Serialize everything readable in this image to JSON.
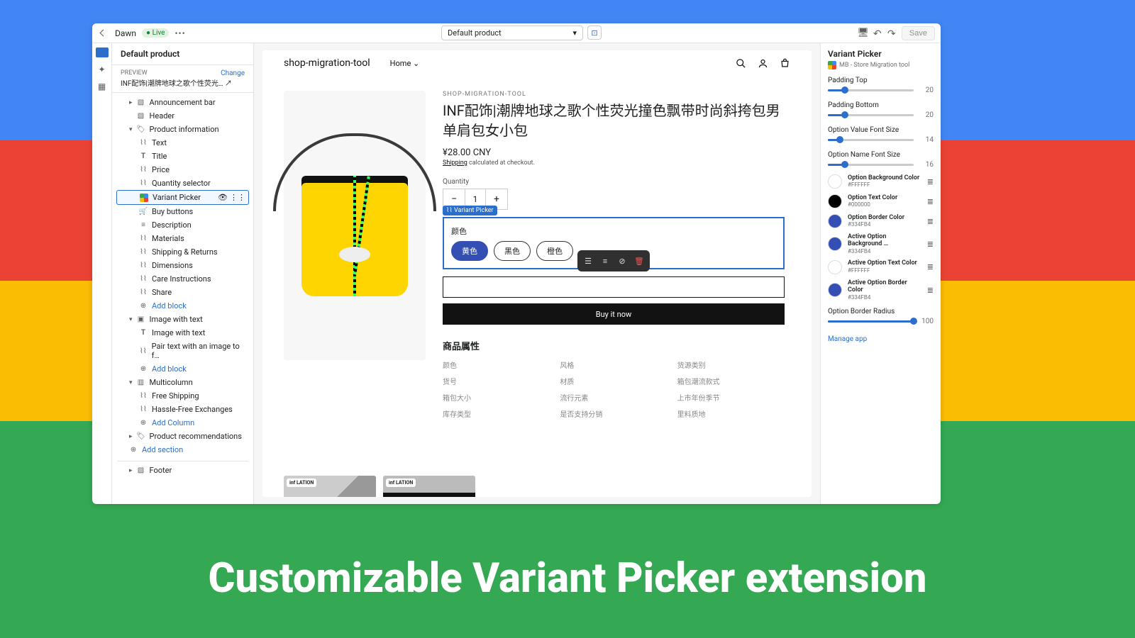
{
  "banner": "Customizable Variant Picker extension",
  "topbar": {
    "theme_name": "Dawn",
    "live_status": "Live",
    "template_select": "Default product",
    "save_label": "Save"
  },
  "left_panel": {
    "template_title": "Default product",
    "preview_label": "PREVIEW",
    "change_label": "Change",
    "preview_product": "INF配饰|潮牌地球之歌个性荧光…",
    "announcement_bar": "Announcement bar",
    "header": "Header",
    "product_info": "Product information",
    "text": "Text",
    "title": "Title",
    "price": "Price",
    "qty_selector": "Quantity selector",
    "variant_picker": "Variant Picker",
    "buy_buttons": "Buy buttons",
    "description": "Description",
    "materials": "Materials",
    "shipping_returns": "Shipping & Returns",
    "dimensions": "Dimensions",
    "care": "Care Instructions",
    "share": "Share",
    "add_block": "Add block",
    "image_with_text": "Image with text",
    "image_with_text_block": "Image with text",
    "pair_text": "Pair text with an image to f…",
    "multicolumn": "Multicolumn",
    "free_shipping": "Free Shipping",
    "hassle_free": "Hassle-Free Exchanges",
    "add_column": "Add Column",
    "product_recs": "Product recommendations",
    "add_section": "Add section",
    "footer": "Footer"
  },
  "store": {
    "name": "shop-migration-tool",
    "home": "Home",
    "vendor": "SHOP-MIGRATION-TOOL",
    "product_title": "INF配饰|潮牌地球之歌个性荧光撞色飘带时尚斜挎包男单肩包女小包",
    "price": "¥28.00 CNY",
    "shipping_link": "Shipping",
    "shipping_text": "calculated at checkout.",
    "quantity_label": "Quantity",
    "quantity_value": "1",
    "variant_tag": "Variant Picker",
    "option_name": "颜色",
    "option_yellow": "黄色",
    "option_black": "黑色",
    "option_orange": "橙色",
    "buy_it_now": "Buy it now",
    "attrs_title": "商品属性",
    "attrs": [
      "颜色",
      "风格",
      "货源类别",
      "货号",
      "材质",
      "箱包潮流款式",
      "箱包大小",
      "流行元素",
      "上市年份季节",
      "库存类型",
      "是否支持分销",
      "里料质地"
    ],
    "thumb_logo": "inf LATION"
  },
  "right_panel": {
    "title": "Variant Picker",
    "app_name": "MB - Store Migration tool",
    "padding_top_label": "Padding Top",
    "padding_top_val": "20",
    "padding_bottom_label": "Padding Bottom",
    "padding_bottom_val": "20",
    "opt_val_font_label": "Option Value Font Size",
    "opt_val_font_val": "14",
    "opt_name_font_label": "Option Name Font Size",
    "opt_name_font_val": "16",
    "border_radius_label": "Option Border Radius",
    "border_radius_val": "100",
    "manage_app": "Manage app",
    "colors": [
      {
        "label": "Option Background Color",
        "hex": "#FFFFFF",
        "swatch": "#FFFFFF"
      },
      {
        "label": "Option Text Color",
        "hex": "#000000",
        "swatch": "#000000"
      },
      {
        "label": "Option Border Color",
        "hex": "#334FB4",
        "swatch": "#334FB4"
      },
      {
        "label": "Active Option Background …",
        "hex": "#334FB4",
        "swatch": "#334FB4"
      },
      {
        "label": "Active Option Text Color",
        "hex": "#FFFFFF",
        "swatch": "#FFFFFF"
      },
      {
        "label": "Active Option Border Color",
        "hex": "#334FB4",
        "swatch": "#334FB4"
      }
    ]
  }
}
